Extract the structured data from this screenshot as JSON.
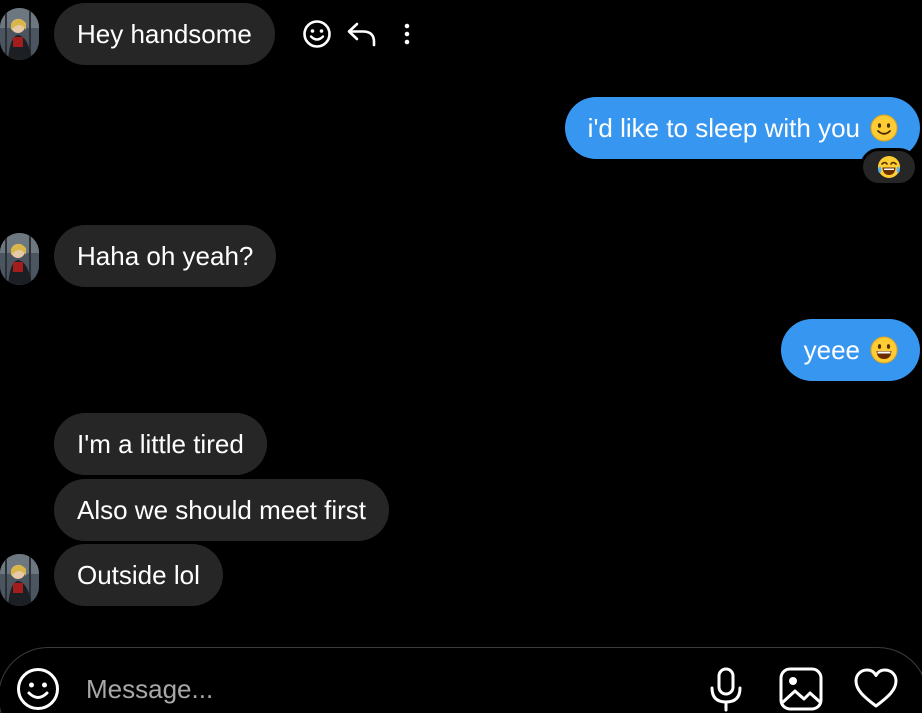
{
  "messages": {
    "m1": {
      "text": "Hey handsome"
    },
    "m2": {
      "text": "i'd like to sleep with you",
      "emoji": "slightly-smiling-face"
    },
    "m3": {
      "text": "Haha oh yeah?"
    },
    "m4": {
      "text": "yeee",
      "emoji": "grinning-face"
    },
    "m5": {
      "text": "I'm a little tired"
    },
    "m6": {
      "text": "Also we should meet first"
    },
    "m7": {
      "text": "Outside lol"
    }
  },
  "reaction": {
    "emoji": "face-with-tears-of-joy"
  },
  "message_actions": [
    "react-icon",
    "reply-icon",
    "more-options-icon"
  ],
  "composer": {
    "placeholder": "Message...",
    "icons": [
      "emoji-icon",
      "microphone-icon",
      "image-icon",
      "heart-icon"
    ]
  },
  "colors": {
    "background": "#000000",
    "incoming_bubble": "#262626",
    "outgoing_bubble": "#3797f0",
    "text": "#ffffff",
    "placeholder": "#a8a8a8"
  }
}
